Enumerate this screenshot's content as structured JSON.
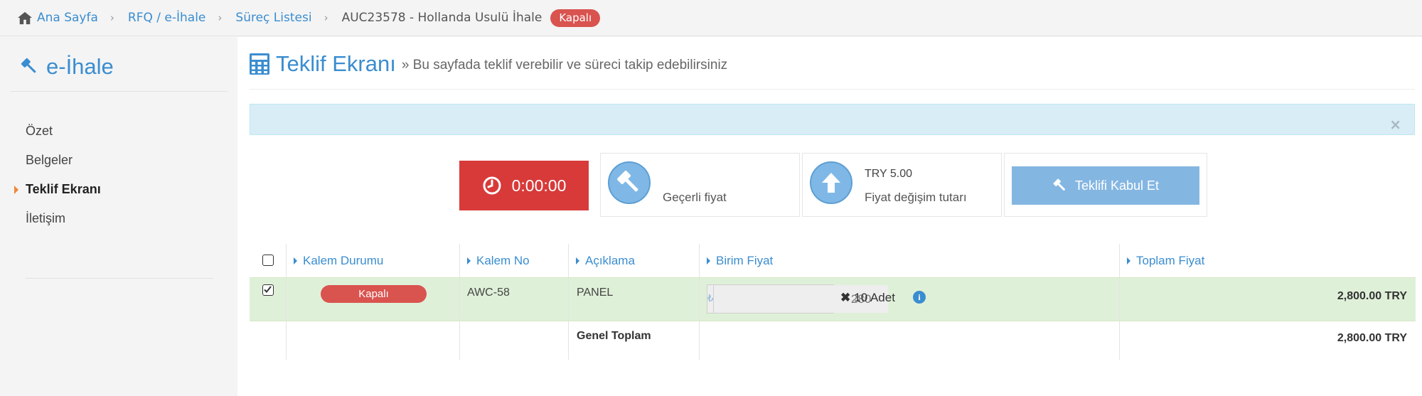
{
  "breadcrumb": {
    "items": [
      "Ana Sayfa",
      "RFQ / e-İhale",
      "Süreç Listesi"
    ],
    "current": "AUC23578 - Hollanda Usulü İhale",
    "status_badge": "Kapalı",
    "separator": "›"
  },
  "sidebar": {
    "brand": "e-İhale",
    "items": [
      {
        "label": "Özet",
        "active": false
      },
      {
        "label": "Belgeler",
        "active": false
      },
      {
        "label": "Teklif Ekranı",
        "active": true
      },
      {
        "label": "İletişim",
        "active": false
      }
    ]
  },
  "page": {
    "title": "Teklif Ekranı",
    "subtitle": "» Bu sayfada teklif verebilir ve süreci takip edebilirsiniz",
    "alert_close": "×"
  },
  "bid": {
    "timer": "0:00:00",
    "current_price_value": "",
    "current_price_label": "Geçerli fiyat",
    "change_amount_value": "TRY 5.00",
    "change_amount_label": "Fiyat değişim tutarı",
    "accept_label": "Teklifi Kabul Et"
  },
  "table": {
    "headers": [
      "Kalem Durumu",
      "Kalem No",
      "Açıklama",
      "Birim Fiyat",
      "Toplam Fiyat"
    ],
    "rows": [
      {
        "status": "Kapalı",
        "item_no": "AWC-58",
        "description": "PANEL",
        "unit_price": "280",
        "quantity": "10 Adet",
        "total": "2,800.00 TRY",
        "checked": true
      }
    ],
    "grand_total_label": "Genel Toplam",
    "grand_total_value": "2,800.00 TRY"
  },
  "colors": {
    "accent": "#3a8dd0",
    "danger": "#d83a3a",
    "success_row": "#dff0d8",
    "alert_info": "#d9edf7",
    "accept_button": "#84b6e2"
  }
}
